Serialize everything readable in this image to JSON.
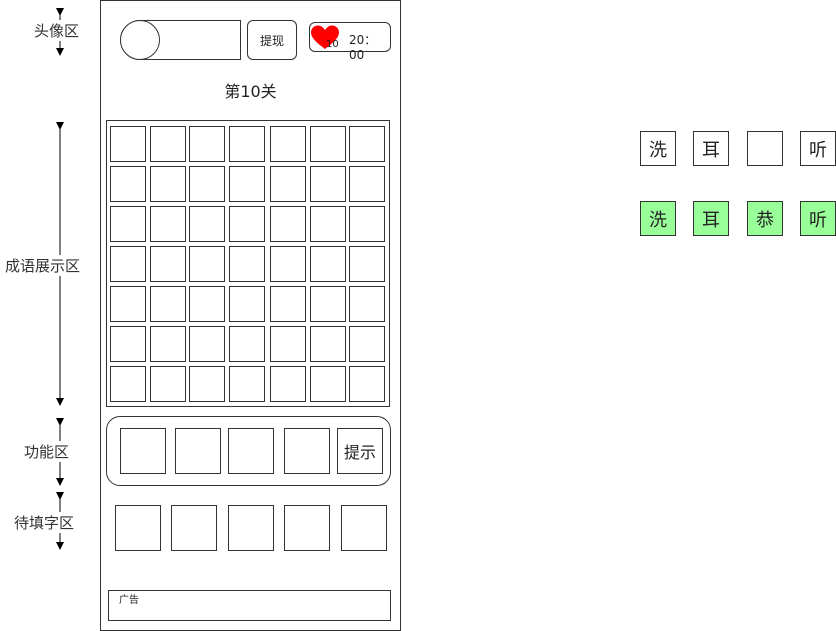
{
  "annotations": {
    "avatar_zone": "头像区",
    "idiom_zone": "成语展示区",
    "function_zone": "功能区",
    "pending_zone": "待填字区"
  },
  "header": {
    "withdraw_label": "提现",
    "lives": "10",
    "timer": "20：00",
    "heart_color": "#ff0000"
  },
  "level_title": "第10关",
  "grid": {
    "rows": 7,
    "cols": 7
  },
  "function_bar": {
    "hint_label": "提示"
  },
  "ad_label": "广告",
  "samples": {
    "row1": [
      "洗",
      "耳",
      "",
      "听"
    ],
    "row2": [
      "洗",
      "耳",
      "恭",
      "听"
    ],
    "complete_color": "#99ff99"
  }
}
